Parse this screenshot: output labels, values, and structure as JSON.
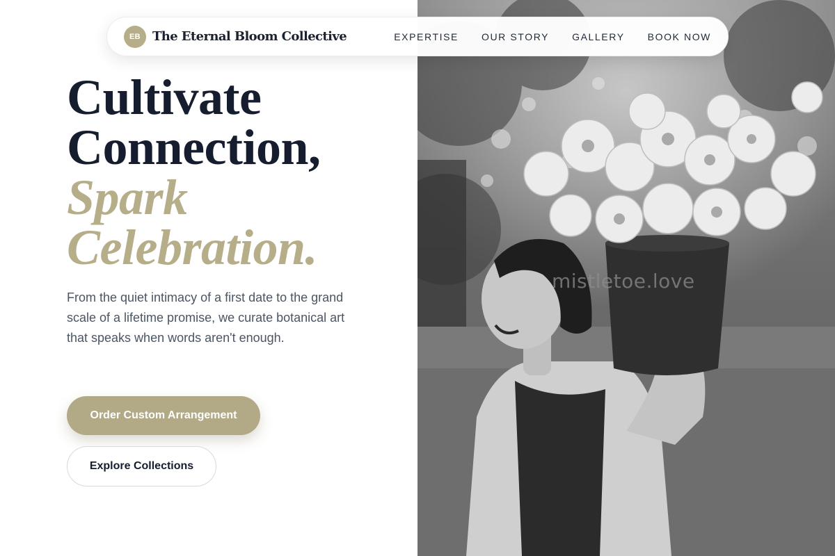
{
  "nav": {
    "logo_initials": "EB",
    "brand_name": "The Eternal Bloom Collective",
    "links": [
      {
        "label": "EXPERTISE"
      },
      {
        "label": "OUR STORY"
      },
      {
        "label": "GALLERY"
      },
      {
        "label": "BOOK NOW"
      }
    ]
  },
  "hero": {
    "headline_line1": "Cultivate",
    "headline_line2": "Connection,",
    "headline_line3": "Spark",
    "headline_line4": "Celebration.",
    "lead": "From the quiet intimacy of a first date to the grand scale of a lifetime promise, we curate botanical art that speaks when words aren't enough.",
    "primary_button": "Order Custom Arrangement",
    "secondary_button": "Explore Collections"
  },
  "photo": {
    "watermark": "mistletoe.love"
  },
  "colors": {
    "accent": "#b6ad89",
    "headline": "#161d2e",
    "body_text": "#4b5563"
  }
}
